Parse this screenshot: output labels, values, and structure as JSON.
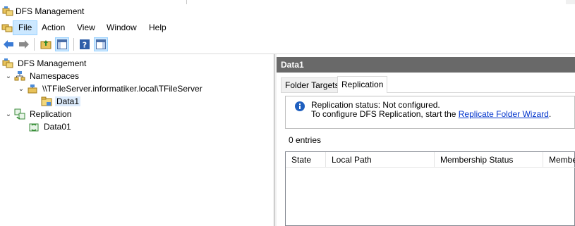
{
  "window": {
    "title": "DFS Management",
    "app_icon": "dfs-management-icon"
  },
  "menu": {
    "items": [
      {
        "label": "File",
        "active": true
      },
      {
        "label": "Action"
      },
      {
        "label": "View"
      },
      {
        "label": "Window"
      },
      {
        "label": "Help"
      }
    ]
  },
  "toolbar": {
    "buttons": [
      "back-icon",
      "forward-icon",
      "up-folder-icon",
      "show-hide-tree-icon",
      "help-icon",
      "show-action-pane-icon"
    ]
  },
  "tree": {
    "root": "DFS Management",
    "namespaces": "Namespaces",
    "namespace_path": "\\\\TFileServer.informatiker.local\\TFileServer",
    "folder": "Data1",
    "replication": "Replication",
    "replication_group": "Data01"
  },
  "pane": {
    "header": "Data1",
    "tabs": [
      {
        "label": "Folder Targets",
        "active": false
      },
      {
        "label": "Replication",
        "active": true
      }
    ],
    "info": {
      "line1": "Replication status: Not configured.",
      "line2_prefix": "To configure DFS Replication, start the ",
      "link": "Replicate Folder Wizard",
      "line2_suffix": "."
    },
    "entries": "0 entries",
    "columns": [
      "State",
      "Local Path",
      "Membership Status",
      "Membe"
    ]
  },
  "colors": {
    "header_bg": "#696969",
    "selection": "#dcebfc",
    "menu_active": "#cce8ff",
    "link": "#0033cc"
  }
}
